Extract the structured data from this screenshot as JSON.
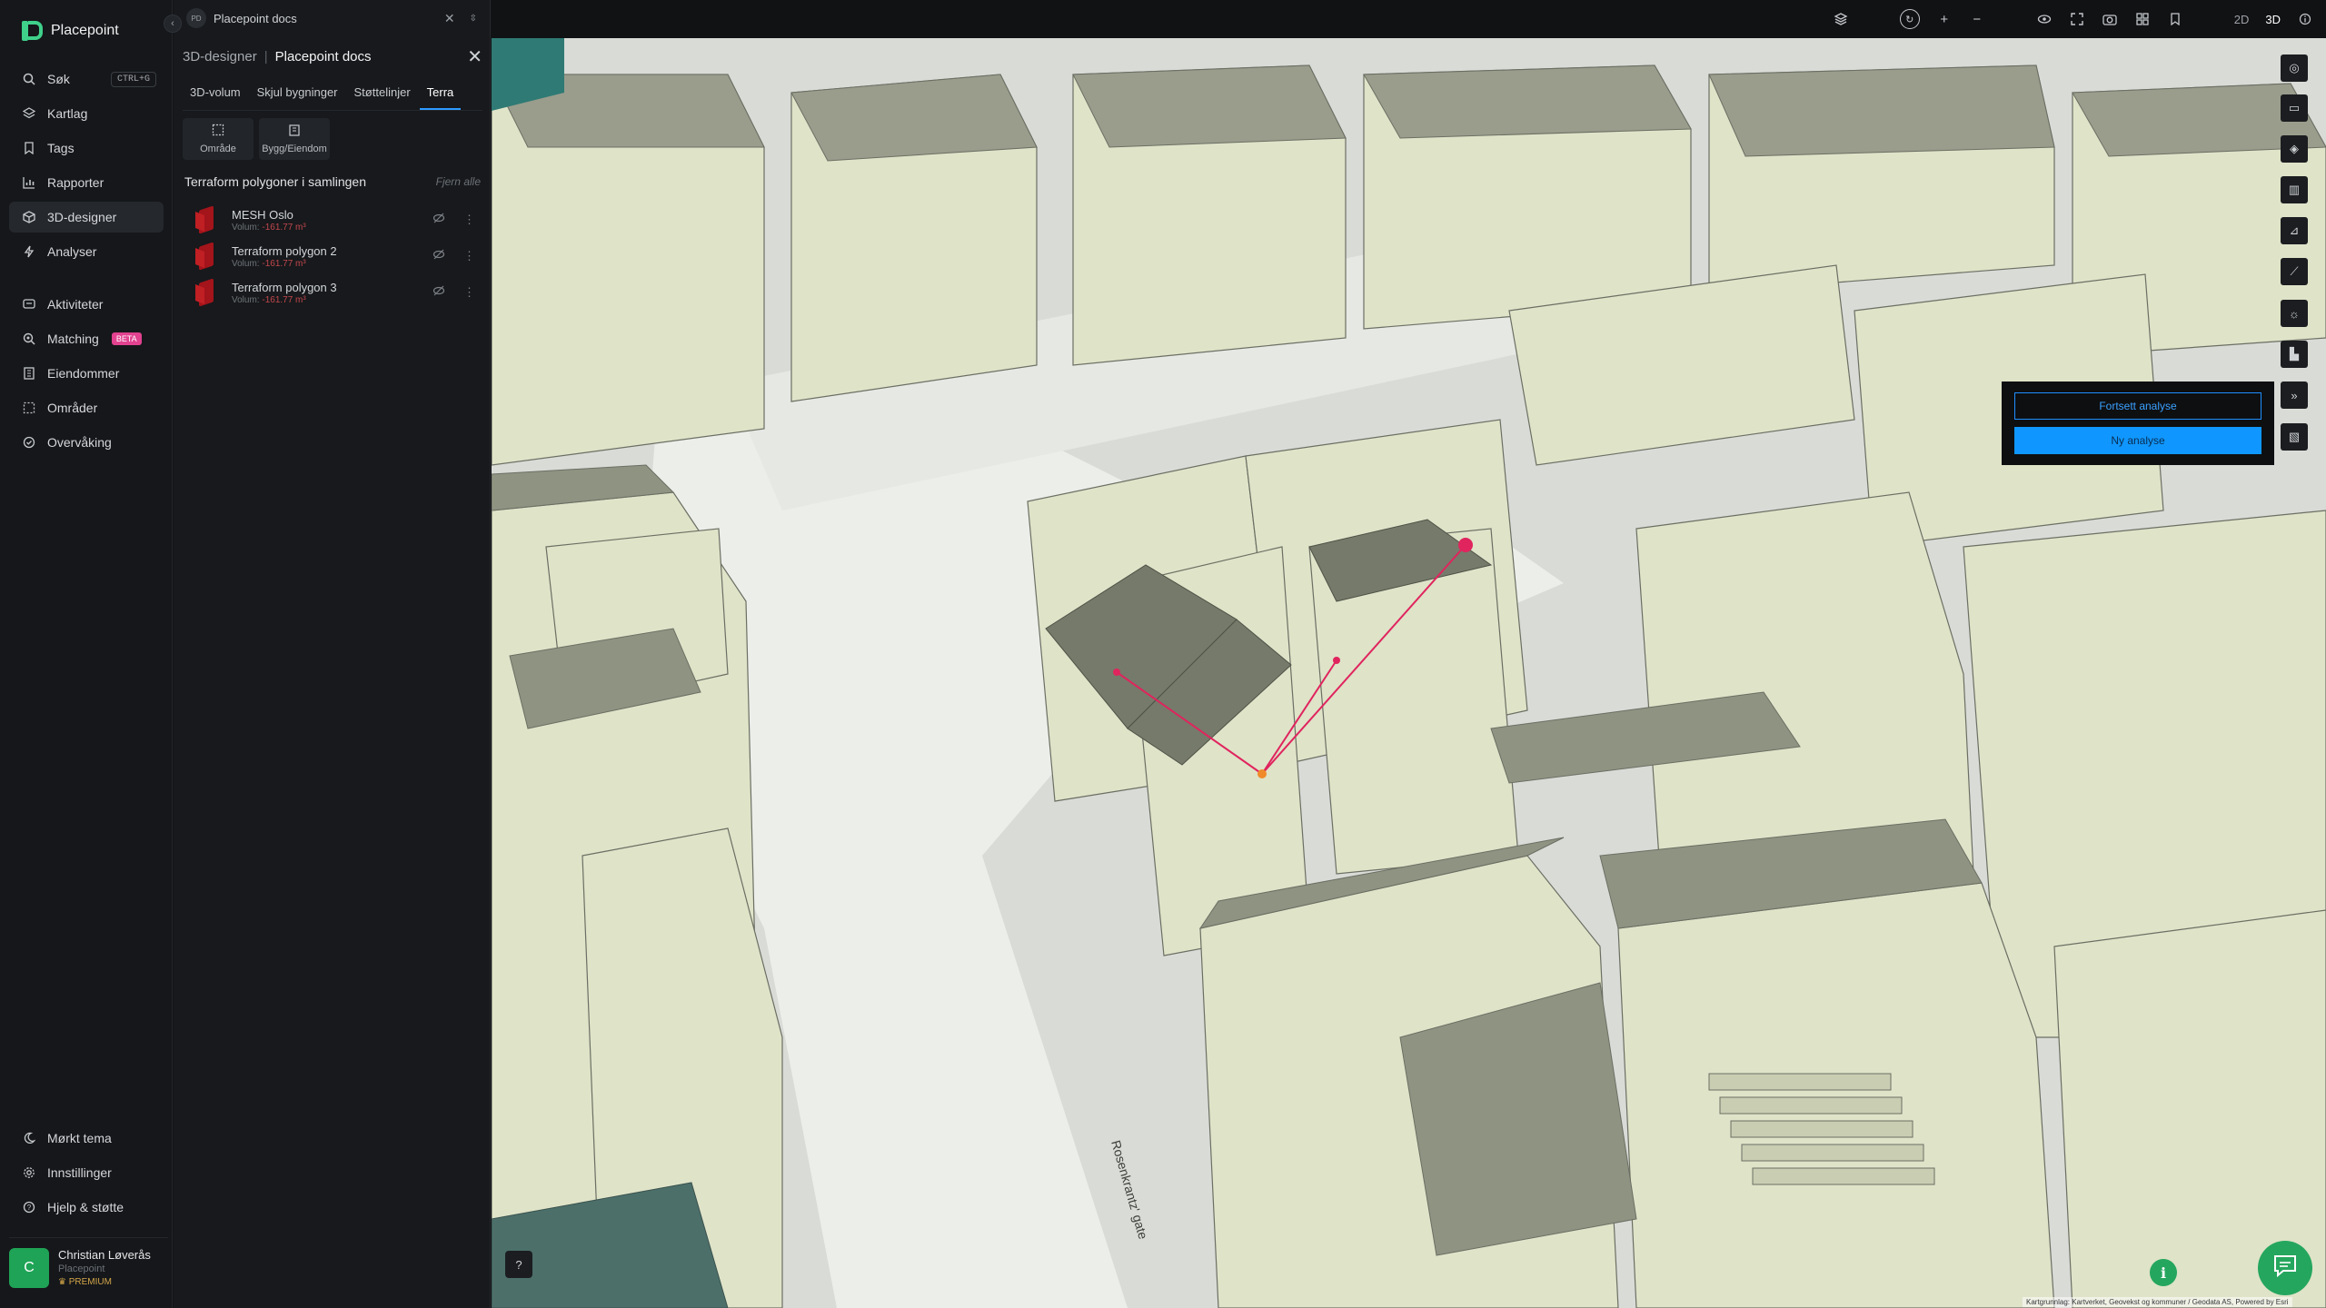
{
  "app": {
    "name": "Placepoint"
  },
  "nav": {
    "items": [
      {
        "label": "Søk",
        "icon": "search-icon",
        "kbd": "CTRL+G"
      },
      {
        "label": "Kartlag",
        "icon": "layers-icon"
      },
      {
        "label": "Tags",
        "icon": "bookmark-icon"
      },
      {
        "label": "Rapporter",
        "icon": "chart-icon"
      },
      {
        "label": "3D-designer",
        "icon": "cube-icon",
        "active": true
      },
      {
        "label": "Analyser",
        "icon": "bolt-icon"
      }
    ],
    "items2": [
      {
        "label": "Aktiviteter",
        "icon": "message-icon"
      },
      {
        "label": "Matching",
        "icon": "match-icon",
        "badge": "BETA"
      },
      {
        "label": "Eiendommer",
        "icon": "property-icon"
      },
      {
        "label": "Områder",
        "icon": "area-icon"
      },
      {
        "label": "Overvåking",
        "icon": "monitor-icon"
      }
    ],
    "bottom": [
      {
        "label": "Mørkt tema",
        "icon": "moon-icon"
      },
      {
        "label": "Innstillinger",
        "icon": "gear-icon"
      },
      {
        "label": "Hjelp & støtte",
        "icon": "help-icon"
      }
    ]
  },
  "user": {
    "initial": "C",
    "name": "Christian Løverås",
    "org": "Placepoint",
    "plan": "PREMIUM"
  },
  "doc_tab": {
    "badge": "PD",
    "title": "Placepoint docs"
  },
  "panel": {
    "crumb": "3D-designer",
    "title": "Placepoint docs",
    "tabs": [
      "3D-volum",
      "Skjul bygninger",
      "Støttelinjer",
      "Terra"
    ],
    "active_tab": "Terra",
    "tools": [
      {
        "label": "Område",
        "icon": "select-area-icon"
      },
      {
        "label": "Bygg/Eiendom",
        "icon": "building-icon"
      }
    ],
    "section_title": "Terraform polygoner i samlingen",
    "remove_all": "Fjern alle",
    "polygons": [
      {
        "name": "MESH Oslo",
        "vol_label": "Volum:",
        "vol_value": "-161.77 m³"
      },
      {
        "name": "Terraform polygon 2",
        "vol_label": "Volum:",
        "vol_value": "-161.77 m³"
      },
      {
        "name": "Terraform polygon 3",
        "vol_label": "Volum:",
        "vol_value": "-161.77 m³"
      }
    ]
  },
  "topbar": {
    "mode_2d": "2D",
    "mode_3d": "3D",
    "active_mode": "3D"
  },
  "analysis": {
    "continue": "Fortsett analyse",
    "new": "Ny analyse"
  },
  "map": {
    "street_label": "Rosenkrantz' gate",
    "attribution": "Kartgrunnlag: Kartverket, Geovekst og kommuner / Geodata AS, Powered by Esri"
  },
  "colors": {
    "accent": "#0f97ff",
    "brand": "#3fd08a",
    "measure_line": "#e0245e",
    "building": "#dfe3c8"
  }
}
